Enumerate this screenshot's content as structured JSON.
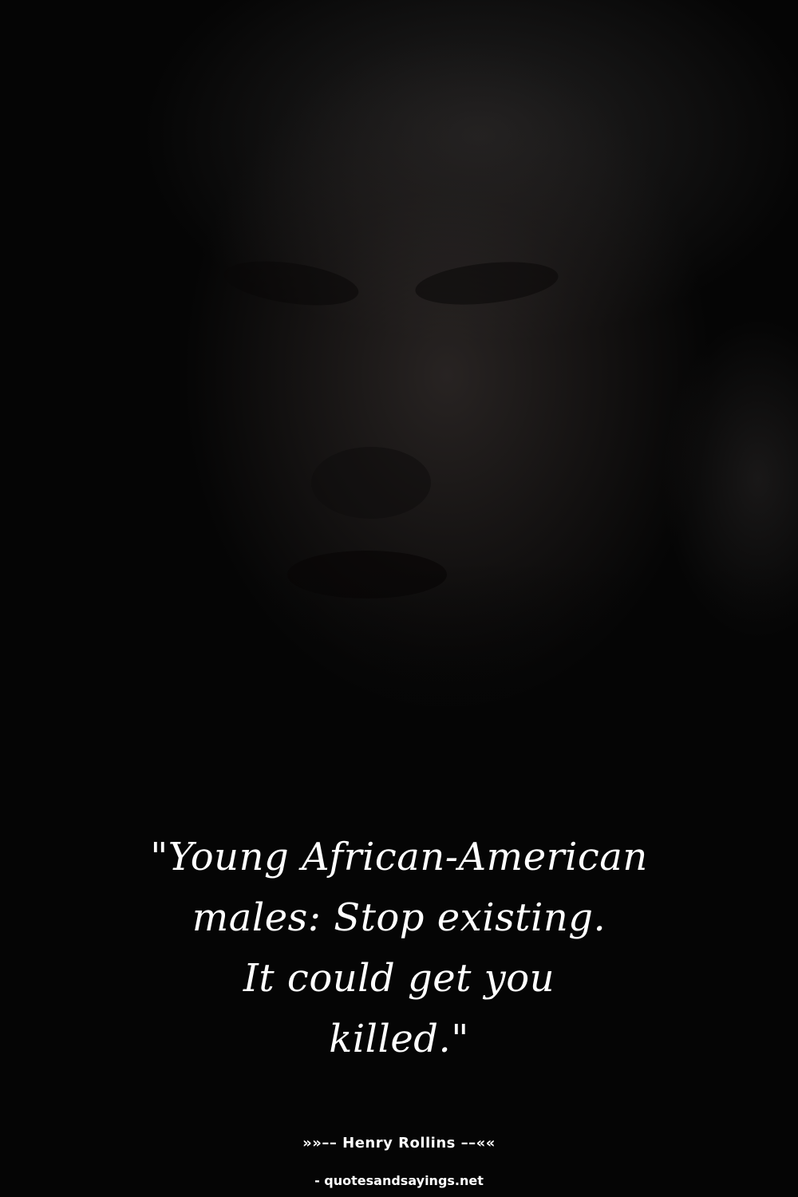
{
  "quote": {
    "lines": [
      "\"Young African-American",
      "males: Stop existing.",
      "It could get you",
      "killed.\""
    ]
  },
  "author": {
    "text": "»»–– Henry Rollins ––««"
  },
  "source": {
    "text": "- quotesandsayings.net"
  },
  "colors": {
    "background": "#050505",
    "text": "#ffffff"
  }
}
